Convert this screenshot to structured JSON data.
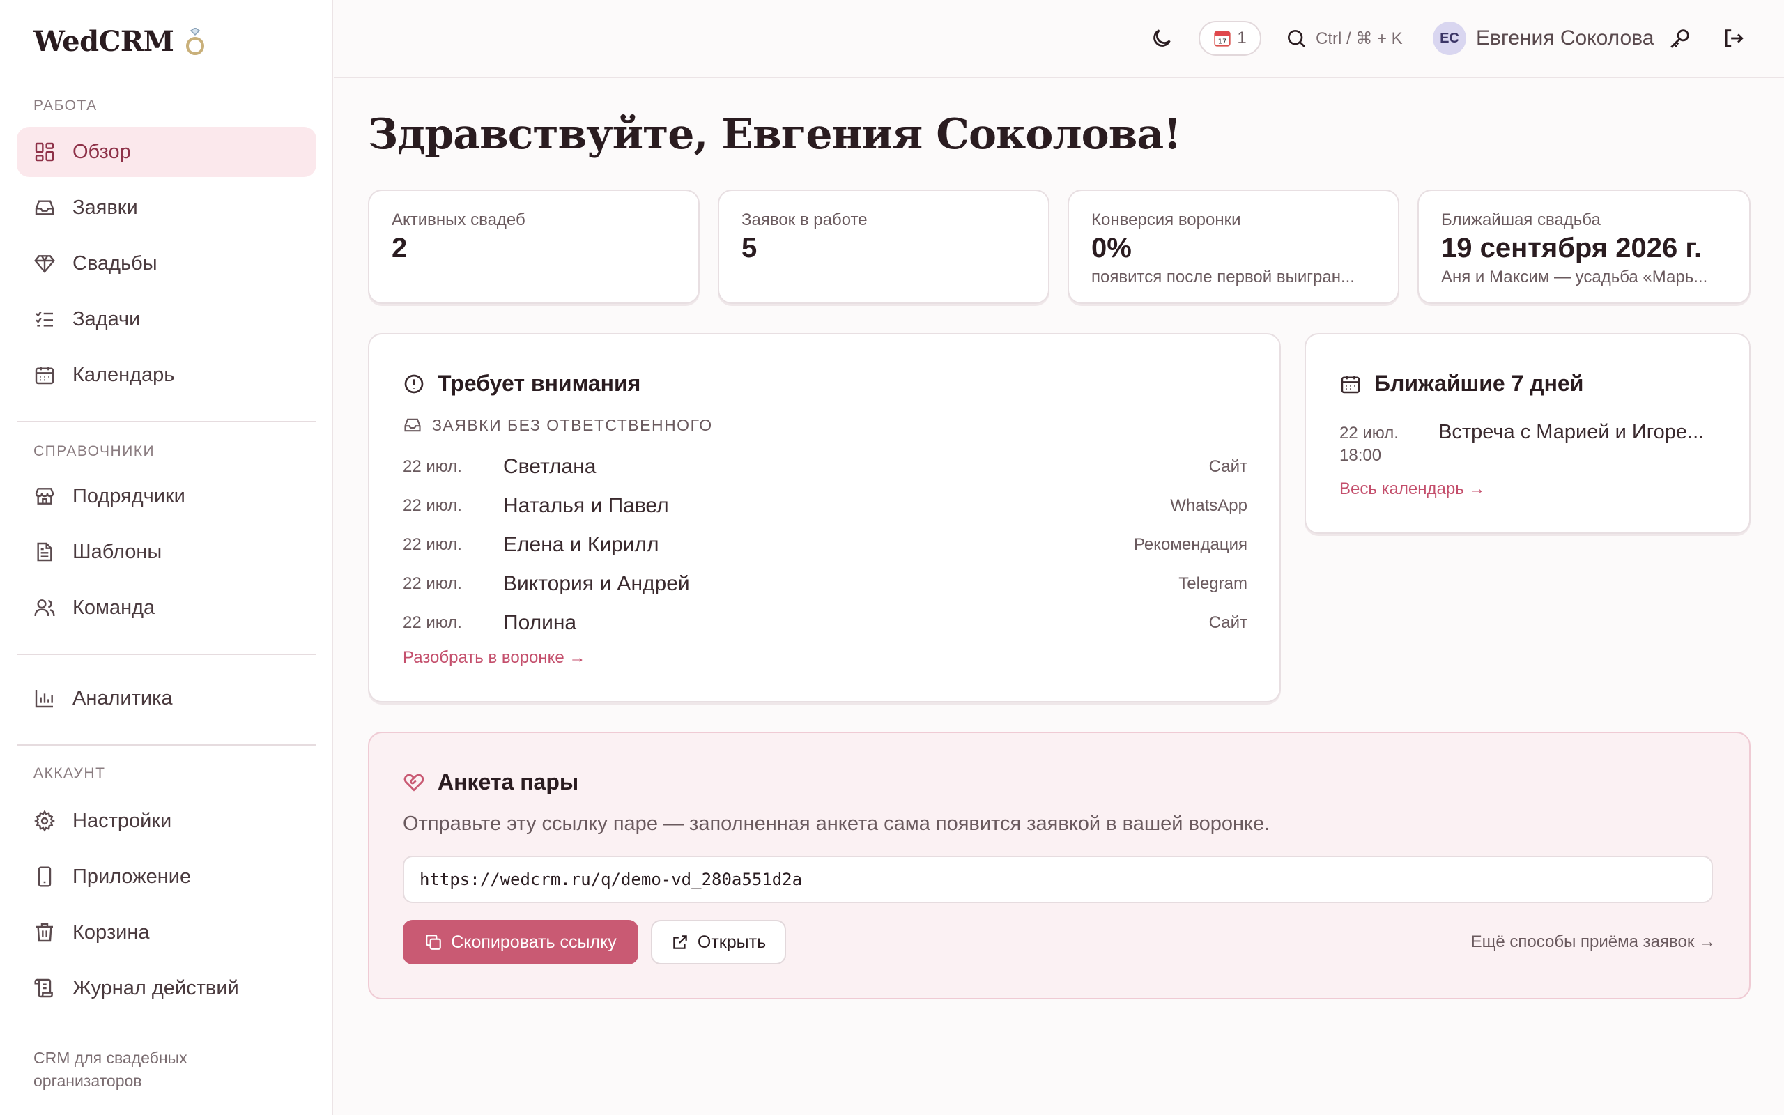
{
  "brand": {
    "name": "WedCRM",
    "icon": "ring-icon"
  },
  "sidebar": {
    "sections": {
      "work": "РАБОТА",
      "refs": "СПРАВОЧНИКИ",
      "account": "АККАУНТ"
    },
    "items": [
      {
        "label": "Обзор",
        "icon": "dashboard-icon",
        "active": true
      },
      {
        "label": "Заявки",
        "icon": "inbox-icon"
      },
      {
        "label": "Свадьбы",
        "icon": "diamond-icon"
      },
      {
        "label": "Задачи",
        "icon": "tasks-icon"
      },
      {
        "label": "Календарь",
        "icon": "calendar-icon"
      },
      {
        "label": "Подрядчики",
        "icon": "store-icon"
      },
      {
        "label": "Шаблоны",
        "icon": "document-icon"
      },
      {
        "label": "Команда",
        "icon": "team-icon"
      },
      {
        "label": "Аналитика",
        "icon": "chart-icon"
      },
      {
        "label": "Настройки",
        "icon": "gear-icon"
      },
      {
        "label": "Приложение",
        "icon": "phone-icon"
      },
      {
        "label": "Корзина",
        "icon": "trash-icon"
      },
      {
        "label": "Журнал действий",
        "icon": "scroll-icon"
      }
    ],
    "footer": "CRM для свадебных организаторов"
  },
  "topbar": {
    "calendar_badge": "1",
    "search_hint": "Ctrl / ⌘ + K",
    "user": {
      "initials": "ЕС",
      "name": "Евгения Соколова"
    }
  },
  "greeting": "Здравствуйте, Евгения Соколова!",
  "stats": [
    {
      "label": "Активных свадеб",
      "value": "2",
      "sub": ""
    },
    {
      "label": "Заявок в работе",
      "value": "5",
      "sub": ""
    },
    {
      "label": "Конверсия воронки",
      "value": "0%",
      "sub": "появится после первой выигран..."
    },
    {
      "label": "Ближайшая свадьба",
      "value": "19 сентября 2026 г.",
      "sub": "Аня и Максим — усадьба «Марь..."
    }
  ],
  "attention": {
    "title": "Требует внимания",
    "subhead": "ЗАЯВКИ БЕЗ ОТВЕТСТВЕННОГО",
    "rows": [
      {
        "date": "22 июл.",
        "name": "Светлана",
        "source": "Сайт"
      },
      {
        "date": "22 июл.",
        "name": "Наталья и Павел",
        "source": "WhatsApp"
      },
      {
        "date": "22 июл.",
        "name": "Елена и Кирилл",
        "source": "Рекомендация"
      },
      {
        "date": "22 июл.",
        "name": "Виктория и Андрей",
        "source": "Telegram"
      },
      {
        "date": "22 июл.",
        "name": "Полина",
        "source": "Сайт"
      }
    ],
    "link": "Разобрать в воронке →"
  },
  "upcoming": {
    "title": "Ближайшие 7 дней",
    "event": {
      "date": "22 июл.",
      "time": "18:00",
      "title": "Встреча с Марией и Игоре..."
    },
    "link": "Весь календарь →"
  },
  "form": {
    "title": "Анкета пары",
    "description": "Отправьте эту ссылку паре — заполненная анкета сама появится заявкой в вашей воронке.",
    "url": "https://wedcrm.ru/q/demo-vd_280a551d2a",
    "copy_label": "Скопировать ссылку",
    "open_label": "Открыть",
    "more_link": "Ещё способы приёма заявок →"
  },
  "colors": {
    "accent": "#c95a73",
    "accent_soft": "#fbe8ec",
    "link": "#c44f6c"
  }
}
